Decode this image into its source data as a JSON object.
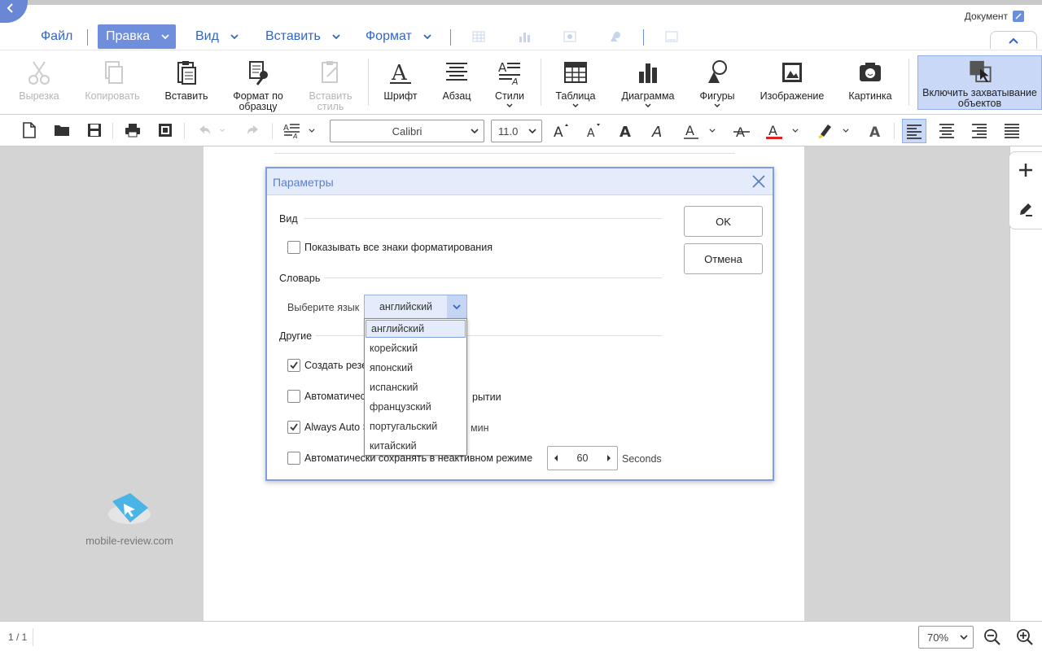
{
  "app": {
    "doc_title": "Документ"
  },
  "menu": {
    "items": [
      {
        "label": "Файл"
      },
      {
        "label": "Правка"
      },
      {
        "label": "Вид"
      },
      {
        "label": "Вставить"
      },
      {
        "label": "Формат"
      }
    ]
  },
  "ribbon": {
    "cut": "Вырезка",
    "copy": "Копировать",
    "paste": "Вставить",
    "format_painter": "Формат по образцу",
    "paste_style": "Вставить стиль",
    "font": "Шрифт",
    "paragraph": "Абзац",
    "styles": "Стили",
    "table": "Таблица",
    "chart": "Диаграмма",
    "shapes": "Фигуры",
    "image": "Изображение",
    "picture": "Картинка",
    "capture": "Включить захватывание объектов"
  },
  "toolbar": {
    "font_name": "Calibri",
    "font_size": "11.0"
  },
  "status": {
    "page": "1 / 1",
    "zoom": "70%"
  },
  "watermark": {
    "text": "mobile-review.com"
  },
  "dialog": {
    "title": "Параметры",
    "ok": "OK",
    "cancel": "Отмена",
    "sections": {
      "view": "Вид",
      "dictionary": "Словарь",
      "other": "Другие"
    },
    "show_formatting": "Показывать все знаки форматирования",
    "choose_language": "Выберите язык",
    "language_value": "английский",
    "create_backup": "Создать резе",
    "auto_open": "Автоматичес",
    "auto_open_tail": "рытии",
    "always_autosave": "Always Auto S",
    "minutes": "мин",
    "auto_save_idle": "Автоматически сохранять в неактивном режиме",
    "idle_value": "60",
    "seconds": "Seconds"
  },
  "dropdown": {
    "options": [
      "английский",
      "корейский",
      "японский",
      "испанский",
      "французский",
      "португальский",
      "китайский"
    ]
  }
}
